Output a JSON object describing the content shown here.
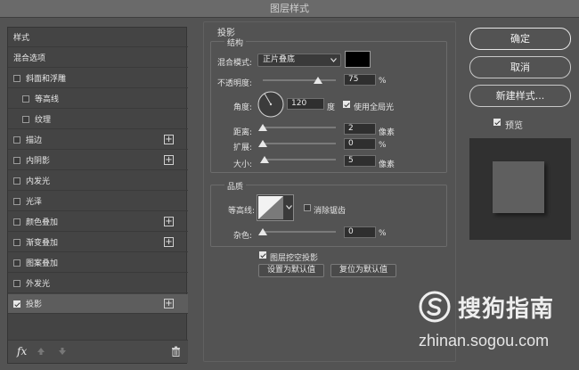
{
  "window": {
    "title": "图层样式"
  },
  "sidebar": {
    "items": [
      {
        "label": "样式",
        "checkbox": false,
        "checked": false,
        "plus": false,
        "indent": false,
        "selected": false
      },
      {
        "label": "混合选项",
        "checkbox": false,
        "checked": false,
        "plus": false,
        "indent": false,
        "selected": false
      },
      {
        "label": "斜面和浮雕",
        "checkbox": true,
        "checked": false,
        "plus": false,
        "indent": false,
        "selected": false
      },
      {
        "label": "等高线",
        "checkbox": true,
        "checked": false,
        "plus": false,
        "indent": true,
        "selected": false
      },
      {
        "label": "纹理",
        "checkbox": true,
        "checked": false,
        "plus": false,
        "indent": true,
        "selected": false
      },
      {
        "label": "描边",
        "checkbox": true,
        "checked": false,
        "plus": true,
        "indent": false,
        "selected": false
      },
      {
        "label": "内阴影",
        "checkbox": true,
        "checked": false,
        "plus": true,
        "indent": false,
        "selected": false
      },
      {
        "label": "内发光",
        "checkbox": true,
        "checked": false,
        "plus": false,
        "indent": false,
        "selected": false
      },
      {
        "label": "光泽",
        "checkbox": true,
        "checked": false,
        "plus": false,
        "indent": false,
        "selected": false
      },
      {
        "label": "颜色叠加",
        "checkbox": true,
        "checked": false,
        "plus": true,
        "indent": false,
        "selected": false
      },
      {
        "label": "渐变叠加",
        "checkbox": true,
        "checked": false,
        "plus": true,
        "indent": false,
        "selected": false
      },
      {
        "label": "图案叠加",
        "checkbox": true,
        "checked": false,
        "plus": false,
        "indent": false,
        "selected": false
      },
      {
        "label": "外发光",
        "checkbox": true,
        "checked": false,
        "plus": false,
        "indent": false,
        "selected": false
      },
      {
        "label": "投影",
        "checkbox": true,
        "checked": true,
        "plus": true,
        "indent": false,
        "selected": true
      }
    ],
    "footer": {
      "fx_label": "fx",
      "up_icon": "arrow-up-icon",
      "down_icon": "arrow-down-icon",
      "delete_icon": "trash-icon"
    }
  },
  "drop_shadow": {
    "heading": "投影",
    "structure": {
      "legend": "结构",
      "blend_mode_label": "混合模式:",
      "blend_mode_value": "正片叠底",
      "shadow_color": "#000000",
      "opacity_label": "不透明度:",
      "opacity_value": "75",
      "opacity_unit": "%",
      "opacity_fraction": 0.75,
      "angle_label": "角度:",
      "angle_value": "120",
      "angle_unit": "度",
      "global_light_label": "使用全局光",
      "global_light_checked": true,
      "distance_label": "距离:",
      "distance_value": "2",
      "distance_unit": "像素",
      "spread_label": "扩展:",
      "spread_value": "0",
      "spread_unit": "%",
      "size_label": "大小:",
      "size_value": "5",
      "size_unit": "像素"
    },
    "quality": {
      "legend": "品质",
      "contour_label": "等高线:",
      "anti_alias_label": "消除锯齿",
      "anti_alias_checked": false,
      "noise_label": "杂色:",
      "noise_value": "0",
      "noise_unit": "%"
    },
    "knockout_label": "图层挖空投影",
    "knockout_checked": true,
    "set_default_label": "设置为默认值",
    "reset_default_label": "复位为默认值"
  },
  "actions": {
    "ok_label": "确定",
    "cancel_label": "取消",
    "new_style_label": "新建样式...",
    "preview_label": "预览",
    "preview_checked": true
  },
  "watermark": {
    "brand": "搜狗指南",
    "url": "zhinan.sogou.com"
  }
}
